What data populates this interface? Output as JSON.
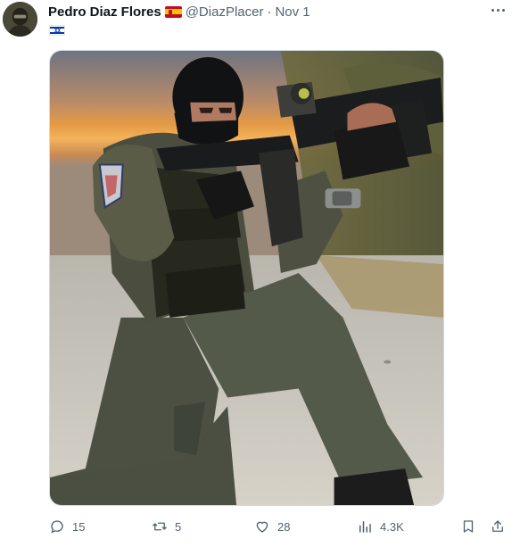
{
  "author": {
    "display_name": "Pedro Diaz Flores",
    "handle": "@DiazPlacer",
    "separator": "·",
    "date": "Nov 1",
    "name_flag": "spain-flag-icon"
  },
  "post": {
    "flag": "israel-flag-icon",
    "media_alt": "photo"
  },
  "actions": {
    "replies": "15",
    "reposts": "5",
    "likes": "28",
    "views": "4.3K"
  },
  "colors": {
    "text_primary": "#0f1419",
    "text_secondary": "#536471",
    "border": "#cfd9de"
  }
}
